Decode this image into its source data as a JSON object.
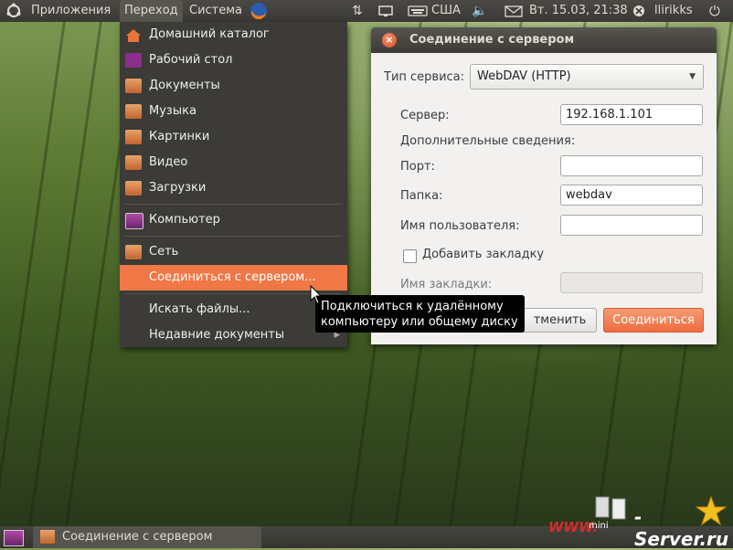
{
  "top_panel": {
    "menus": [
      "Приложения",
      "Переход",
      "Система"
    ],
    "keyboard_layout": "США",
    "datetime": "Вт. 15.03, 21:38",
    "user": "llirikks"
  },
  "places_menu": {
    "items": [
      {
        "label": "Домашний каталог",
        "icon": "home-icon"
      },
      {
        "label": "Рабочий стол",
        "icon": "desktop-icon"
      },
      {
        "label": "Документы",
        "icon": "folder-documents-icon"
      },
      {
        "label": "Музыка",
        "icon": "folder-music-icon"
      },
      {
        "label": "Картинки",
        "icon": "folder-pictures-icon"
      },
      {
        "label": "Видео",
        "icon": "folder-video-icon"
      },
      {
        "label": "Загрузки",
        "icon": "folder-downloads-icon"
      },
      {
        "label": "Компьютер",
        "icon": "computer-icon"
      },
      {
        "label": "Сеть",
        "icon": "network-icon"
      },
      {
        "label": "Соединиться с сервером...",
        "icon": ""
      },
      {
        "label": "Искать файлы...",
        "icon": ""
      },
      {
        "label": "Недавние документы",
        "icon": ""
      }
    ],
    "highlighted": "Соединиться с сервером..."
  },
  "tooltip": {
    "line1": "Подключиться к удалённому",
    "line2": "компьютеру или общему диску"
  },
  "dialog": {
    "title": "Соединение с сервером",
    "service_type_label": "Тип сервиса:",
    "service_type_value": "WebDAV (HTTP)",
    "server_label": "Сервер:",
    "server_value": "192.168.1.101",
    "extra_info_label": "Дополнительные сведения:",
    "port_label": "Порт:",
    "port_value": "",
    "folder_label": "Папка:",
    "folder_value": "webdav",
    "username_label": "Имя пользователя:",
    "username_value": "",
    "bookmark_checkbox_label": "Добавить закладку",
    "bookmark_name_label": "Имя закладки:",
    "bookmark_name_value": "",
    "cancel_button": "Отменить",
    "cancel_button_visible": "тменить",
    "connect_button": "Соединиться"
  },
  "taskbar": {
    "window_title": "Соединение с сервером"
  },
  "watermark": {
    "www": "WWW.",
    "mini": "mini",
    "server": "-Server.ru"
  },
  "colors": {
    "accent": "#f07746",
    "panel": "#3c3b37",
    "dialog_bg": "#f2f1f0"
  }
}
